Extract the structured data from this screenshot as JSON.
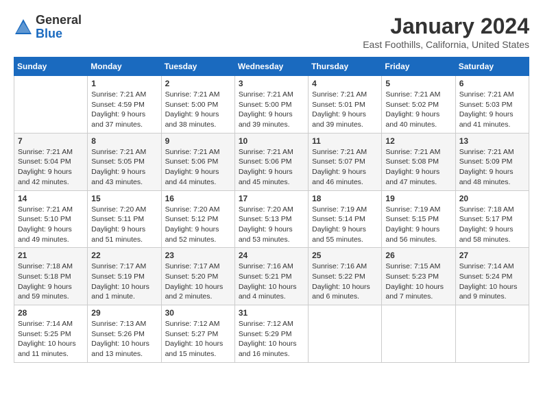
{
  "logo": {
    "general": "General",
    "blue": "Blue"
  },
  "title": {
    "month_year": "January 2024",
    "location": "East Foothills, California, United States"
  },
  "weekdays": [
    "Sunday",
    "Monday",
    "Tuesday",
    "Wednesday",
    "Thursday",
    "Friday",
    "Saturday"
  ],
  "weeks": [
    [
      {
        "day": "",
        "sunrise": "",
        "sunset": "",
        "daylight": ""
      },
      {
        "day": "1",
        "sunrise": "Sunrise: 7:21 AM",
        "sunset": "Sunset: 4:59 PM",
        "daylight": "Daylight: 9 hours and 37 minutes."
      },
      {
        "day": "2",
        "sunrise": "Sunrise: 7:21 AM",
        "sunset": "Sunset: 5:00 PM",
        "daylight": "Daylight: 9 hours and 38 minutes."
      },
      {
        "day": "3",
        "sunrise": "Sunrise: 7:21 AM",
        "sunset": "Sunset: 5:00 PM",
        "daylight": "Daylight: 9 hours and 39 minutes."
      },
      {
        "day": "4",
        "sunrise": "Sunrise: 7:21 AM",
        "sunset": "Sunset: 5:01 PM",
        "daylight": "Daylight: 9 hours and 39 minutes."
      },
      {
        "day": "5",
        "sunrise": "Sunrise: 7:21 AM",
        "sunset": "Sunset: 5:02 PM",
        "daylight": "Daylight: 9 hours and 40 minutes."
      },
      {
        "day": "6",
        "sunrise": "Sunrise: 7:21 AM",
        "sunset": "Sunset: 5:03 PM",
        "daylight": "Daylight: 9 hours and 41 minutes."
      }
    ],
    [
      {
        "day": "7",
        "sunrise": "Sunrise: 7:21 AM",
        "sunset": "Sunset: 5:04 PM",
        "daylight": "Daylight: 9 hours and 42 minutes."
      },
      {
        "day": "8",
        "sunrise": "Sunrise: 7:21 AM",
        "sunset": "Sunset: 5:05 PM",
        "daylight": "Daylight: 9 hours and 43 minutes."
      },
      {
        "day": "9",
        "sunrise": "Sunrise: 7:21 AM",
        "sunset": "Sunset: 5:06 PM",
        "daylight": "Daylight: 9 hours and 44 minutes."
      },
      {
        "day": "10",
        "sunrise": "Sunrise: 7:21 AM",
        "sunset": "Sunset: 5:06 PM",
        "daylight": "Daylight: 9 hours and 45 minutes."
      },
      {
        "day": "11",
        "sunrise": "Sunrise: 7:21 AM",
        "sunset": "Sunset: 5:07 PM",
        "daylight": "Daylight: 9 hours and 46 minutes."
      },
      {
        "day": "12",
        "sunrise": "Sunrise: 7:21 AM",
        "sunset": "Sunset: 5:08 PM",
        "daylight": "Daylight: 9 hours and 47 minutes."
      },
      {
        "day": "13",
        "sunrise": "Sunrise: 7:21 AM",
        "sunset": "Sunset: 5:09 PM",
        "daylight": "Daylight: 9 hours and 48 minutes."
      }
    ],
    [
      {
        "day": "14",
        "sunrise": "Sunrise: 7:21 AM",
        "sunset": "Sunset: 5:10 PM",
        "daylight": "Daylight: 9 hours and 49 minutes."
      },
      {
        "day": "15",
        "sunrise": "Sunrise: 7:20 AM",
        "sunset": "Sunset: 5:11 PM",
        "daylight": "Daylight: 9 hours and 51 minutes."
      },
      {
        "day": "16",
        "sunrise": "Sunrise: 7:20 AM",
        "sunset": "Sunset: 5:12 PM",
        "daylight": "Daylight: 9 hours and 52 minutes."
      },
      {
        "day": "17",
        "sunrise": "Sunrise: 7:20 AM",
        "sunset": "Sunset: 5:13 PM",
        "daylight": "Daylight: 9 hours and 53 minutes."
      },
      {
        "day": "18",
        "sunrise": "Sunrise: 7:19 AM",
        "sunset": "Sunset: 5:14 PM",
        "daylight": "Daylight: 9 hours and 55 minutes."
      },
      {
        "day": "19",
        "sunrise": "Sunrise: 7:19 AM",
        "sunset": "Sunset: 5:15 PM",
        "daylight": "Daylight: 9 hours and 56 minutes."
      },
      {
        "day": "20",
        "sunrise": "Sunrise: 7:18 AM",
        "sunset": "Sunset: 5:17 PM",
        "daylight": "Daylight: 9 hours and 58 minutes."
      }
    ],
    [
      {
        "day": "21",
        "sunrise": "Sunrise: 7:18 AM",
        "sunset": "Sunset: 5:18 PM",
        "daylight": "Daylight: 9 hours and 59 minutes."
      },
      {
        "day": "22",
        "sunrise": "Sunrise: 7:17 AM",
        "sunset": "Sunset: 5:19 PM",
        "daylight": "Daylight: 10 hours and 1 minute."
      },
      {
        "day": "23",
        "sunrise": "Sunrise: 7:17 AM",
        "sunset": "Sunset: 5:20 PM",
        "daylight": "Daylight: 10 hours and 2 minutes."
      },
      {
        "day": "24",
        "sunrise": "Sunrise: 7:16 AM",
        "sunset": "Sunset: 5:21 PM",
        "daylight": "Daylight: 10 hours and 4 minutes."
      },
      {
        "day": "25",
        "sunrise": "Sunrise: 7:16 AM",
        "sunset": "Sunset: 5:22 PM",
        "daylight": "Daylight: 10 hours and 6 minutes."
      },
      {
        "day": "26",
        "sunrise": "Sunrise: 7:15 AM",
        "sunset": "Sunset: 5:23 PM",
        "daylight": "Daylight: 10 hours and 7 minutes."
      },
      {
        "day": "27",
        "sunrise": "Sunrise: 7:14 AM",
        "sunset": "Sunset: 5:24 PM",
        "daylight": "Daylight: 10 hours and 9 minutes."
      }
    ],
    [
      {
        "day": "28",
        "sunrise": "Sunrise: 7:14 AM",
        "sunset": "Sunset: 5:25 PM",
        "daylight": "Daylight: 10 hours and 11 minutes."
      },
      {
        "day": "29",
        "sunrise": "Sunrise: 7:13 AM",
        "sunset": "Sunset: 5:26 PM",
        "daylight": "Daylight: 10 hours and 13 minutes."
      },
      {
        "day": "30",
        "sunrise": "Sunrise: 7:12 AM",
        "sunset": "Sunset: 5:27 PM",
        "daylight": "Daylight: 10 hours and 15 minutes."
      },
      {
        "day": "31",
        "sunrise": "Sunrise: 7:12 AM",
        "sunset": "Sunset: 5:29 PM",
        "daylight": "Daylight: 10 hours and 16 minutes."
      },
      {
        "day": "",
        "sunrise": "",
        "sunset": "",
        "daylight": ""
      },
      {
        "day": "",
        "sunrise": "",
        "sunset": "",
        "daylight": ""
      },
      {
        "day": "",
        "sunrise": "",
        "sunset": "",
        "daylight": ""
      }
    ]
  ]
}
